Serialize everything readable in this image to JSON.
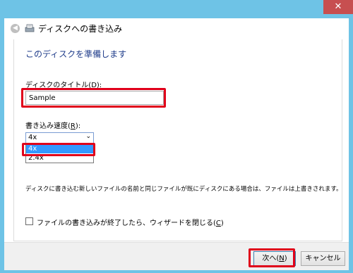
{
  "window": {
    "close_glyph": "✕",
    "title": "ディスクへの書き込み"
  },
  "content": {
    "main_instruction": "このディスクを準備します",
    "disc_title": {
      "label_prefix": "ディスクのタイトル(",
      "label_key": "D",
      "label_suffix": "):",
      "value": "Sample"
    },
    "speed": {
      "label_prefix": "書き込み速度(",
      "label_key": "R",
      "label_suffix": "):",
      "selected": "4x",
      "options": [
        "4x",
        "2.4x"
      ]
    },
    "info": "ディスクに書き込む新しいファイルの名前と同じファイルが既にディスクにある場合は、ファイルは上書きされます。",
    "close_wizard": {
      "label_prefix": "ファイルの書き込みが終了したら、ウィザードを閉じる(",
      "label_key": "C",
      "label_suffix": ")",
      "checked": false
    }
  },
  "footer": {
    "next": {
      "prefix": "次へ(",
      "key": "N",
      "suffix": ")"
    },
    "cancel": "キャンセル"
  },
  "colors": {
    "titlebar": "#6ec3e6",
    "close_button": "#c74f50",
    "instruction_text": "#1f3c8a",
    "selection": "#3399ff",
    "highlight": "#e0001a"
  }
}
